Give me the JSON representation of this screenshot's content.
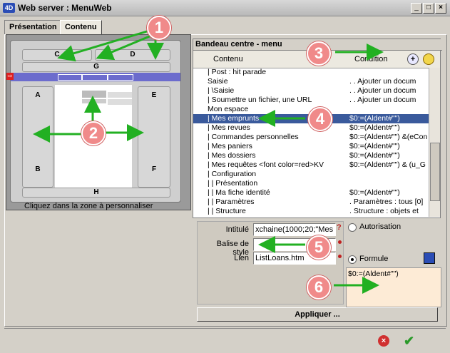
{
  "window": {
    "title": "Web server : MenuWeb",
    "app_icon": "4D"
  },
  "tabs": [
    {
      "label": "Présentation"
    },
    {
      "label": "Contenu"
    }
  ],
  "preview": {
    "zones": {
      "c": "C",
      "d": "D",
      "g": "G",
      "a": "A",
      "e": "E",
      "b": "B",
      "f": "F",
      "h": "H"
    },
    "hint": "Cliquez dans la zone à personnaliser"
  },
  "content_panel": {
    "title": "Bandeau centre - menu",
    "col_content": "Contenu",
    "col_condition": "Condition",
    "rows": [
      {
        "content": "| Post : hit parade",
        "condition": "",
        "selected": false
      },
      {
        "content": "Saisie",
        "condition": ". . Ajouter un docum",
        "selected": false
      },
      {
        "content": "| \\Saisie",
        "condition": ". . Ajouter un docum",
        "selected": false
      },
      {
        "content": "| Soumettre un fichier, une URL",
        "condition": ". . Ajouter un docum",
        "selected": false
      },
      {
        "content": "Mon espace",
        "condition": "",
        "selected": false
      },
      {
        "content": "| Mes emprunts",
        "condition": "$0:=(Aldent#\"\")",
        "selected": true
      },
      {
        "content": "| Mes revues",
        "condition": "$0:=(Aldent#\"\")",
        "selected": false
      },
      {
        "content": "| Commandes personnelles",
        "condition": "$0:=(Aldent#\"\") &(eCon",
        "selected": false
      },
      {
        "content": "| Mes paniers",
        "condition": "$0:=(Aldent#\"\")",
        "selected": false
      },
      {
        "content": "| Mes dossiers",
        "condition": "$0:=(Aldent#\"\")",
        "selected": false
      },
      {
        "content": "| Mes requêtes <font color=red>KV",
        "condition": "$0:=(Aldent#\"\") & (u_G",
        "selected": false
      },
      {
        "content": "| Configuration",
        "condition": "",
        "selected": false
      },
      {
        "content": "| | Présentation",
        "condition": "",
        "selected": false
      },
      {
        "content": "| | Ma fiche identité",
        "condition": "$0:=(Aldent#\"\")",
        "selected": false
      },
      {
        "content": "| | Paramètres",
        "condition": ". Paramètres : tous [0]",
        "selected": false
      },
      {
        "content": "| | Structure",
        "condition": ". Structure : objets et",
        "selected": false
      }
    ]
  },
  "form": {
    "intitule_label": "Intitulé",
    "intitule_value": "xchaine(1000;20;\"Mes",
    "balise_label": "Balise de style",
    "balise_value": "",
    "lien_label": "Lien",
    "lien_value": "ListLoans.htm",
    "autorisation_label": "Autorisation",
    "formule_label": "Formule",
    "formule_value": "$0:=(Aldent#\"\")"
  },
  "apply_button": "Appliquer ...",
  "callouts": [
    "1",
    "2",
    "3",
    "4",
    "5",
    "6"
  ],
  "colors": {
    "selection": "#3a5a9c",
    "callout": "#f08a8a",
    "arrow": "#22b022",
    "formula_bg": "#fdebd6"
  },
  "icons": [
    "minimize-icon",
    "maximize-icon",
    "close-icon",
    "add-icon",
    "erase-icon",
    "move-up-icon",
    "indent-icon",
    "move-down-icon",
    "question-icon",
    "cancel-icon",
    "ok-icon"
  ]
}
